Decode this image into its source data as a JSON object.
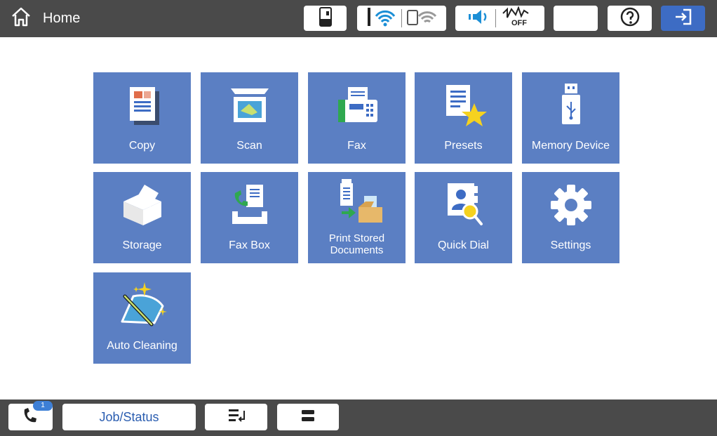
{
  "header": {
    "title": "Home",
    "icons": {
      "home": "home-icon",
      "ink": "ink-level-icon",
      "wifi": "wifi-icon",
      "wifi_direct": "wifi-direct-icon",
      "sound": "sound-icon",
      "fax_signal": "fax-signal-icon",
      "sleep": "sleep-moon-icon",
      "help": "help-icon",
      "login": "login-icon"
    },
    "fax_signal_state": "OFF",
    "accent_color": "#3d6cc4"
  },
  "tiles": [
    {
      "label": "Copy",
      "icon": "copy-icon"
    },
    {
      "label": "Scan",
      "icon": "scan-icon"
    },
    {
      "label": "Fax",
      "icon": "fax-icon"
    },
    {
      "label": "Presets",
      "icon": "presets-icon"
    },
    {
      "label": "Memory Device",
      "icon": "usb-memory-icon"
    },
    {
      "label": "Storage",
      "icon": "storage-icon"
    },
    {
      "label": "Fax Box",
      "icon": "fax-box-icon"
    },
    {
      "label_line1": "Print Stored",
      "label_line2": "Documents",
      "icon": "print-stored-documents-icon"
    },
    {
      "label": "Quick Dial",
      "icon": "quick-dial-icon"
    },
    {
      "label": "Settings",
      "icon": "gear-icon"
    },
    {
      "label": "Auto Cleaning",
      "icon": "auto-cleaning-icon"
    }
  ],
  "tile_color": "#5b7fc3",
  "footer": {
    "fax_badge": "1",
    "job_status_label": "Job/Status",
    "icons": {
      "fax": "fax-phone-icon",
      "tray": "paper-tray-icon",
      "stop": "stop-icon"
    }
  }
}
